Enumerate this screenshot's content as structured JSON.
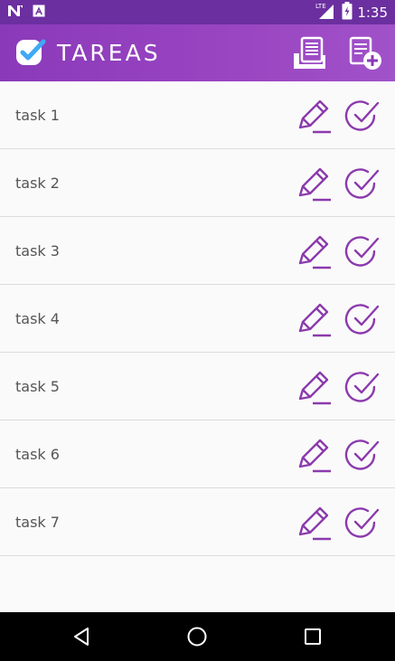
{
  "status_bar": {
    "time": "1:35",
    "network_label": "LTE",
    "left_icons": [
      "n-notification-icon",
      "a-notification-icon"
    ],
    "right_icons": [
      "signal-icon",
      "battery-charging-icon"
    ]
  },
  "app_bar": {
    "title": "TAREAS",
    "logo_icon": "check-badge-icon",
    "actions": [
      {
        "name": "archive",
        "icon": "archive-list-icon"
      },
      {
        "name": "add",
        "icon": "add-task-icon"
      }
    ]
  },
  "colors": {
    "status_bar": "#6b2fa0",
    "app_bar_start": "#8a3ab9",
    "app_bar_end": "#a052c8",
    "accent": "#8b3aad",
    "logo_check": "#3fa9f5",
    "divider": "#dcdcdc",
    "task_text": "#555555"
  },
  "tasks": [
    {
      "label": "task 1"
    },
    {
      "label": "task 2"
    },
    {
      "label": "task 3"
    },
    {
      "label": "task 4"
    },
    {
      "label": "task 5"
    },
    {
      "label": "task 6"
    },
    {
      "label": "task 7"
    }
  ],
  "nav_bar": {
    "buttons": [
      "back-icon",
      "home-icon",
      "recents-icon"
    ]
  }
}
